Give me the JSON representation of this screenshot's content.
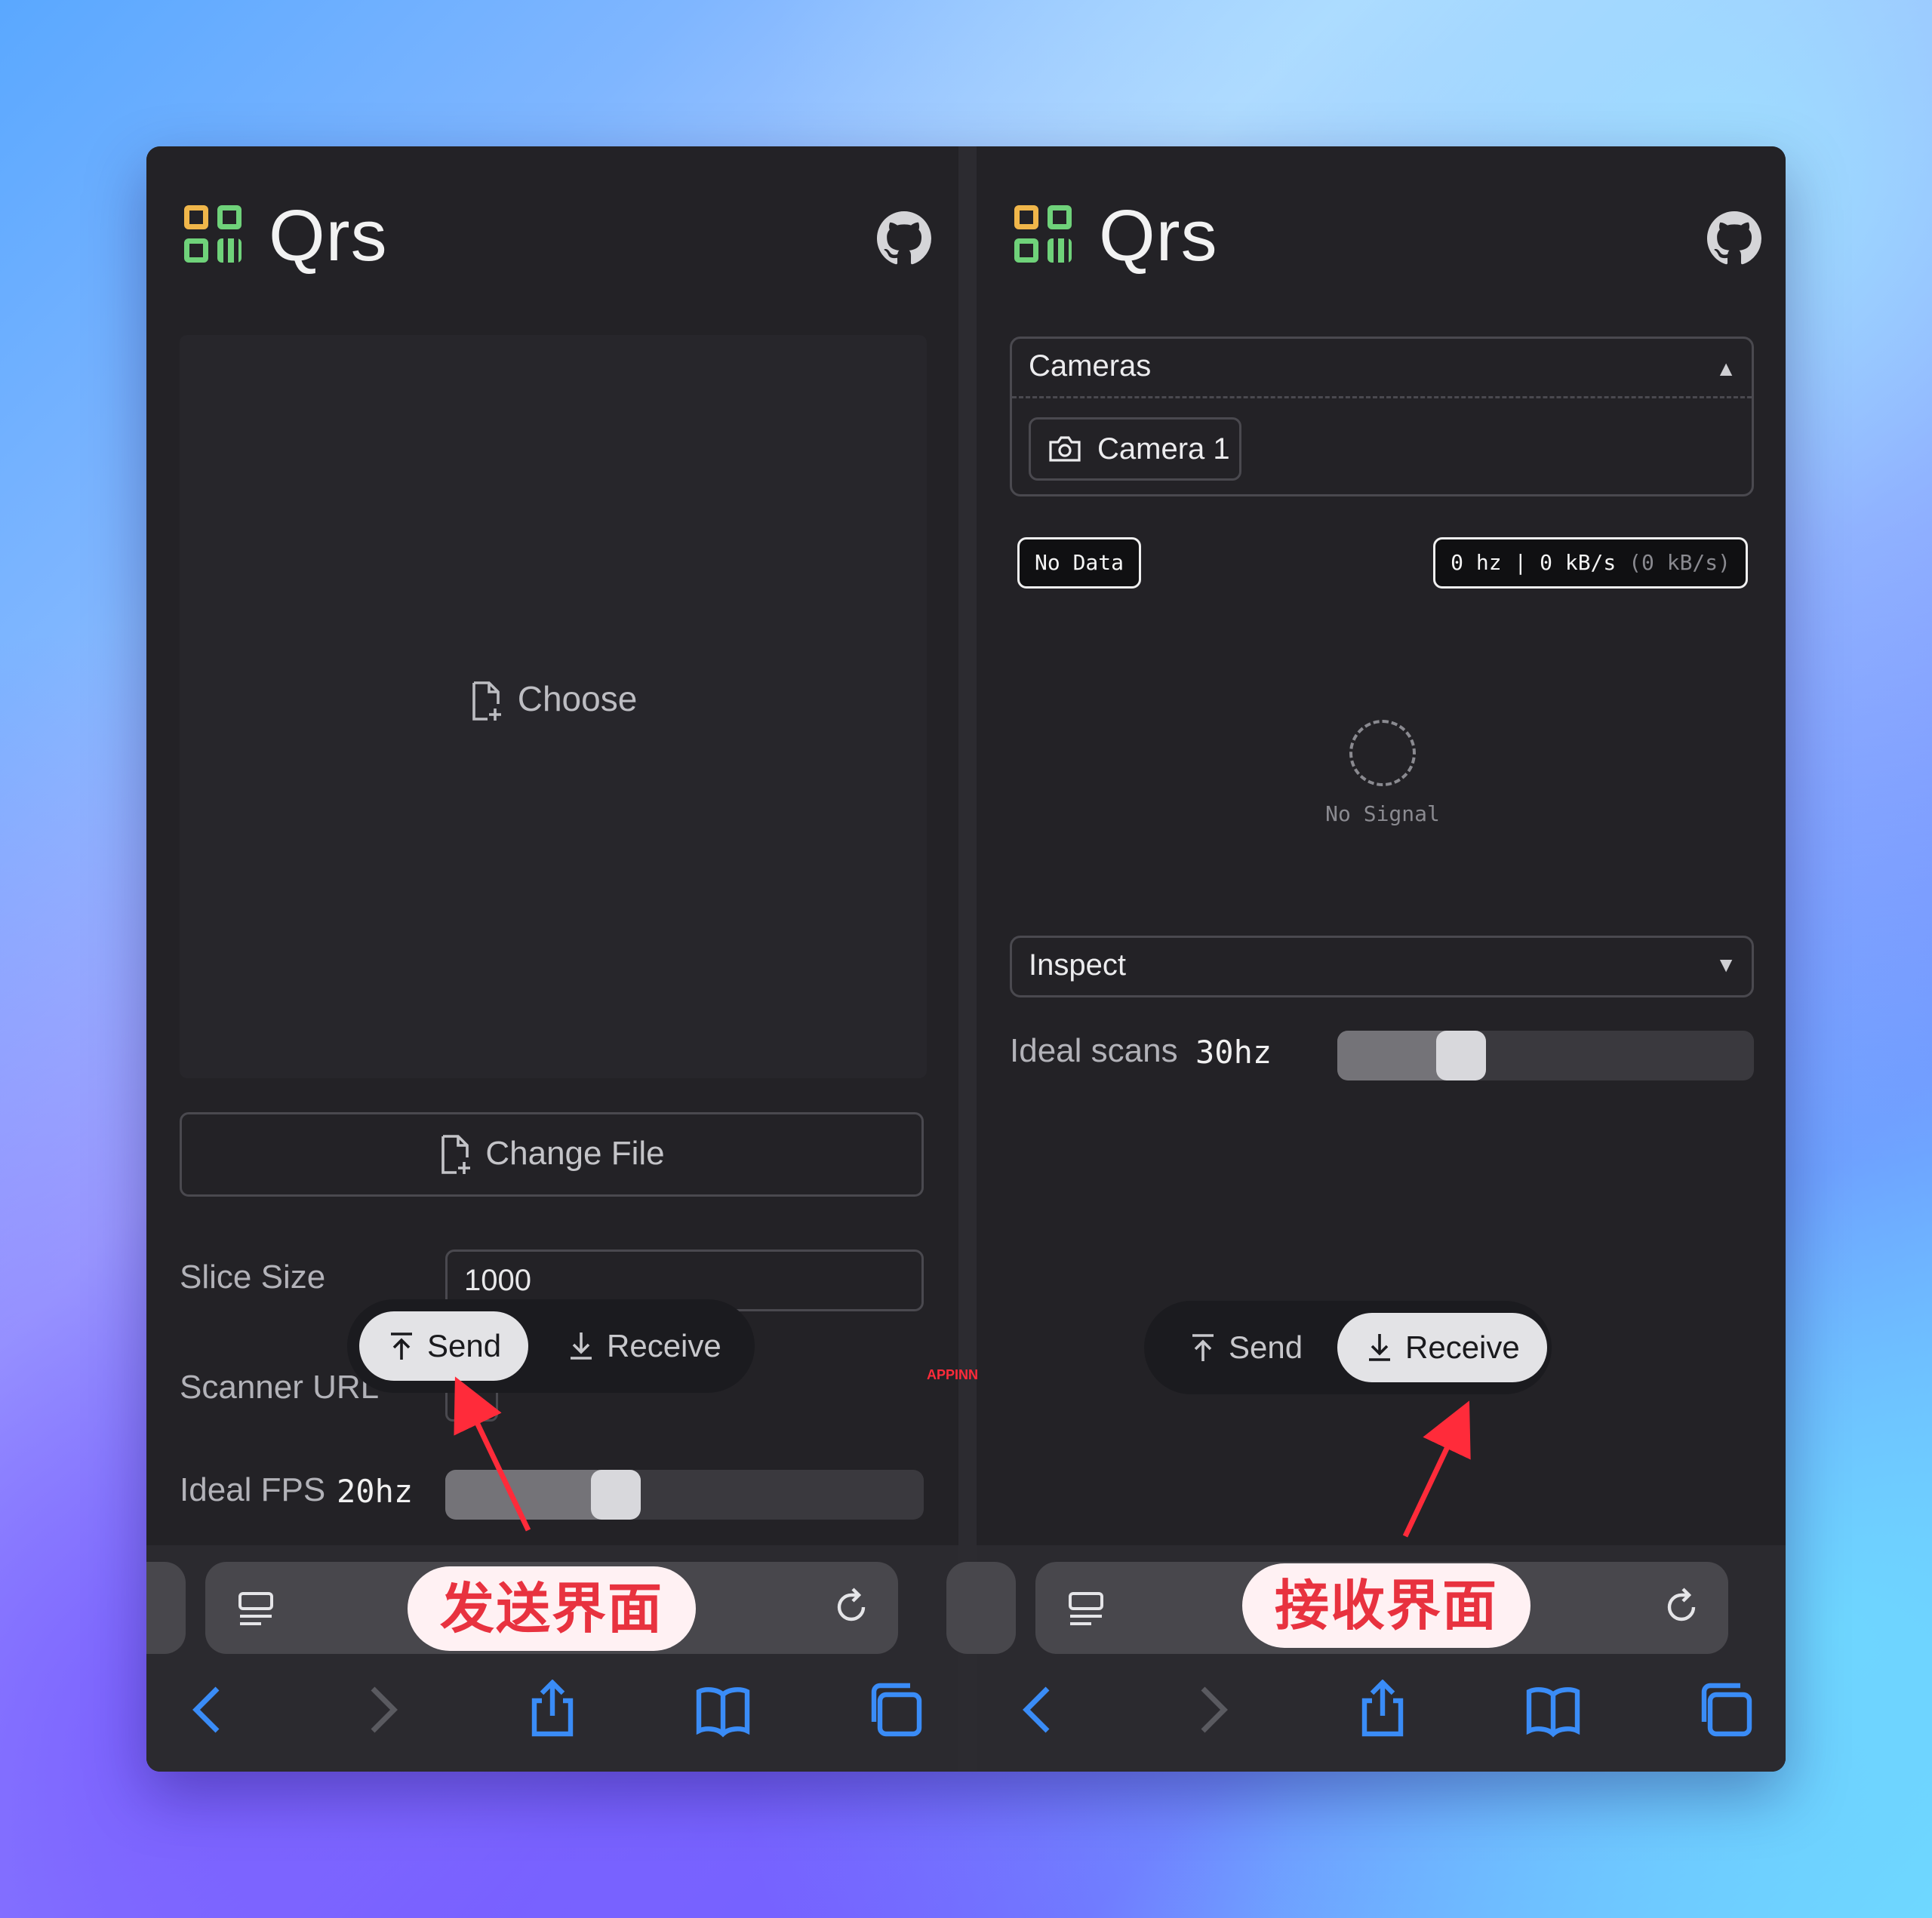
{
  "left": {
    "app_title": "Qrs",
    "choose_label": "Choose",
    "change_file_label": "Change File",
    "slice_size_label": "Slice Size",
    "slice_size_value": "1000",
    "scanner_url_label": "Scanner URL",
    "scanner_url_checked": "✕",
    "ideal_fps_label": "Ideal FPS",
    "ideal_fps_value": "20hz",
    "ideal_fps_slider_fraction": 0.34,
    "toggle": {
      "send": "Send",
      "receive": "Receive",
      "active": "send"
    },
    "annotation": "发送界面"
  },
  "right": {
    "app_title": "Qrs",
    "cameras_title": "Cameras",
    "camera_item": "Camera 1",
    "badge_left": "No Data",
    "badge_right_main": "0 hz | 0 kB/s",
    "badge_right_dim": "(0 kB/s)",
    "no_signal": "No Signal",
    "inspect_title": "Inspect",
    "ideal_scans_label": "Ideal scans",
    "ideal_scans_value": "30hz",
    "ideal_scans_slider_fraction": 0.27,
    "toggle": {
      "send": "Send",
      "receive": "Receive",
      "active": "receive"
    },
    "annotation": "接收界面"
  },
  "watermark": "APPINN",
  "icons": [
    "qrs-logo-icon",
    "github-icon",
    "file-plus-icon",
    "camera-icon",
    "upload-icon",
    "download-icon",
    "reader-icon",
    "reload-icon",
    "back-icon",
    "forward-icon",
    "share-icon",
    "bookmarks-icon",
    "tabs-icon"
  ],
  "colors": {
    "accent_red": "#e8323f",
    "panel_bg": "#232226",
    "safari_blue": "#3a8cf7"
  }
}
